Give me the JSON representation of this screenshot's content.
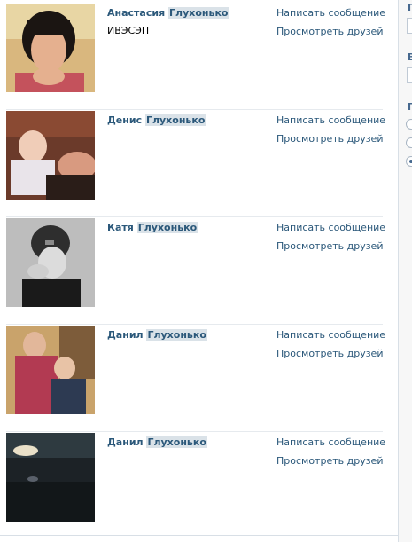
{
  "people": [
    {
      "first_name": "Анастасия",
      "last_name": "Глухонько",
      "subtitle": "ИВЭСЭП"
    },
    {
      "first_name": "Денис",
      "last_name": "Глухонько",
      "subtitle": ""
    },
    {
      "first_name": "Катя",
      "last_name": "Глухонько",
      "subtitle": ""
    },
    {
      "first_name": "Данил",
      "last_name": "Глухонько",
      "subtitle": ""
    },
    {
      "first_name": "Данил",
      "last_name": "Глухонько",
      "subtitle": ""
    }
  ],
  "actions": {
    "write_message": "Написать сообщение",
    "view_friends": "Просмотреть друзей"
  },
  "sidebar": {
    "letters": [
      "Г",
      "В",
      "П"
    ]
  }
}
